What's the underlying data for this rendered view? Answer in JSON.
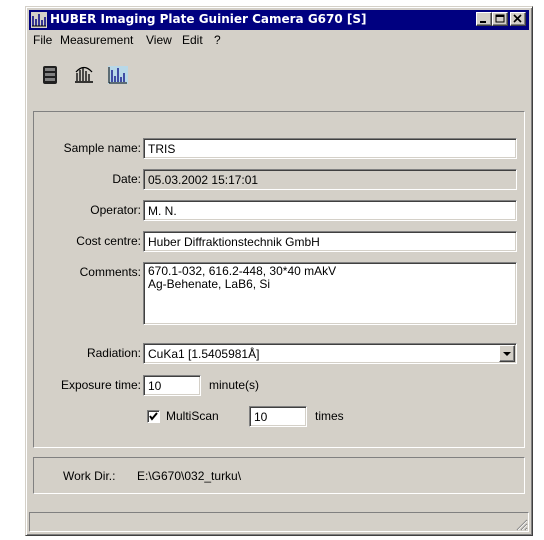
{
  "window": {
    "title": "HUBER Imaging Plate Guinier Camera G670 [S]"
  },
  "menu": [
    "File",
    "Measurement",
    "View",
    "Edit",
    "?"
  ],
  "toolbar": {
    "icons": [
      "database-icon",
      "camera-scan-icon",
      "diffractogram-icon"
    ]
  },
  "form": {
    "sample_name": {
      "label": "Sample name:",
      "value": "TRIS"
    },
    "date": {
      "label": "Date:",
      "value": "05.03.2002 15:17:01"
    },
    "operator": {
      "label": "Operator:",
      "value": "M. N."
    },
    "cost_centre": {
      "label": "Cost centre:",
      "value": "Huber Diffraktionstechnik GmbH"
    },
    "comments": {
      "label": "Comments:",
      "value": "670.1-032, 616.2-448, 30*40 mAkV\nAg-Behenate, LaB6, Si"
    },
    "radiation": {
      "label": "Radiation:",
      "value": "CuKa1 [1.5405981Å]"
    },
    "exposure": {
      "label": "Exposure time:",
      "value": "10",
      "unit": "minute(s)"
    },
    "multiscan": {
      "label": "MultiScan",
      "checked": true,
      "value": "10",
      "unit": "times"
    }
  },
  "workdir": {
    "label": "Work Dir.:",
    "value": "E:\\G670\\032_turku\\"
  },
  "colors": {
    "title_bar": "#000080",
    "face": "#d4d0c8"
  }
}
